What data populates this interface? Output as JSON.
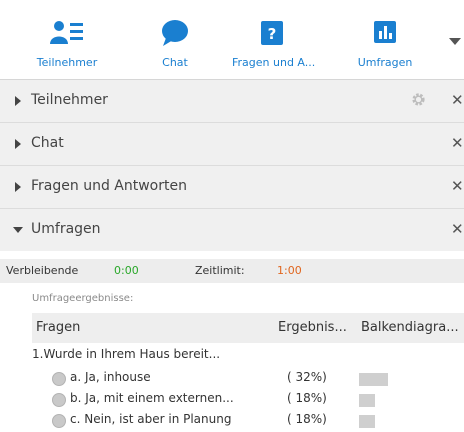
{
  "toolbar": {
    "items": [
      {
        "label": "Teilnehmer",
        "icon": "participants-icon"
      },
      {
        "label": "Chat",
        "icon": "chat-icon"
      },
      {
        "label": "Fragen und A...",
        "icon": "question-icon"
      },
      {
        "label": "Umfragen",
        "icon": "poll-icon"
      }
    ],
    "more_icon": "dropdown-arrow-icon",
    "accent_color": "#1a7fd0"
  },
  "panels": [
    {
      "title": "Teilnehmer",
      "expanded": false
    },
    {
      "title": "Chat",
      "expanded": false
    },
    {
      "title": "Fragen und Antworten",
      "expanded": false
    },
    {
      "title": "Umfragen",
      "expanded": true
    }
  ],
  "close_symbol": "✕",
  "poll": {
    "remaining_label": "Verbleibende",
    "remaining_value": "0:00",
    "remaining_color": "#2aa82a",
    "limit_label": "Zeitlimit:",
    "limit_value": "1:00",
    "limit_color": "#e0661f",
    "results_label": "Umfrageergebnisse:",
    "columns": [
      "Fragen",
      "Ergebnis...",
      "Balkendiagra..."
    ],
    "question": "1.Wurde in Ihrem Haus bereit...",
    "answers": [
      {
        "text": "a.  Ja, inhouse",
        "result": "( 32%)",
        "fraction": 0.32
      },
      {
        "text": "b.  Ja, mit einem externen...",
        "result": "( 18%)",
        "fraction": 0.18
      },
      {
        "text": "c.  Nein, ist aber in Planung",
        "result": "( 18%)",
        "fraction": 0.18
      }
    ]
  }
}
